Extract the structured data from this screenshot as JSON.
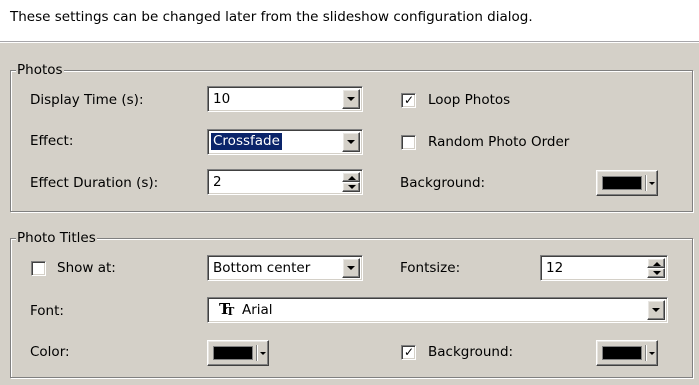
{
  "banner": {
    "text": "These settings can be changed later from the slideshow configuration dialog."
  },
  "photos": {
    "legend": "Photos",
    "display_time": {
      "label": "Display Time (s):",
      "value": "10"
    },
    "effect": {
      "label": "Effect:",
      "value": "Crossfade"
    },
    "effect_duration": {
      "label": "Effect Duration (s):",
      "value": "2"
    },
    "loop_photos": {
      "label": "Loop Photos",
      "checked": true
    },
    "random_order": {
      "label": "Random Photo Order",
      "checked": false
    },
    "background": {
      "label": "Background:",
      "color": "#000000"
    }
  },
  "titles": {
    "legend": "Photo Titles",
    "show_at": {
      "label": "Show at:",
      "checked": false,
      "value": "Bottom center"
    },
    "fontsize": {
      "label": "Fontsize:",
      "value": "12"
    },
    "font": {
      "label": "Font:",
      "value": "Arial",
      "icon": "truetype-font-icon"
    },
    "color": {
      "label": "Color:",
      "color": "#000000"
    },
    "background": {
      "label": "Background:",
      "checked": true,
      "color": "#000000"
    }
  },
  "colors": {
    "selection": "#0a246a",
    "face": "#d4d0c8",
    "window": "#ffffff"
  }
}
